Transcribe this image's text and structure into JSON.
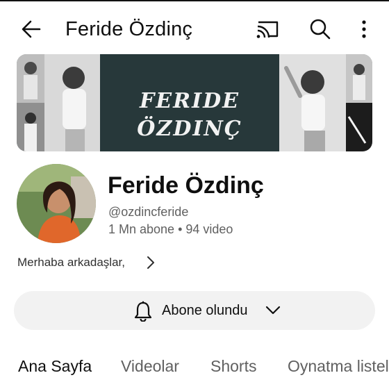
{
  "header": {
    "title": "Feride Özdinç",
    "icons": {
      "back": "arrow-left-icon",
      "cast": "cast-icon",
      "search": "search-icon",
      "more": "more-vert-icon"
    }
  },
  "banner": {
    "text": "FERIDE ÖZDINÇ"
  },
  "channel": {
    "name": "Feride Özdinç",
    "handle": "@ozdincferide",
    "subscribers": "1 Mn abone",
    "separator": "•",
    "videos": "94 video",
    "description": "Merhaba arkadaşlar,"
  },
  "subscribe": {
    "label": "Abone olundu"
  },
  "tabs": [
    {
      "label": "Ana Sayfa",
      "active": true
    },
    {
      "label": "Videolar",
      "active": false
    },
    {
      "label": "Shorts",
      "active": false
    },
    {
      "label": "Oynatma listeleri",
      "active": false
    }
  ],
  "colors": {
    "text": "#0f0f0f",
    "secondary": "#606060",
    "pill": "#f2f2f2",
    "banner_bg": "#27383a"
  }
}
